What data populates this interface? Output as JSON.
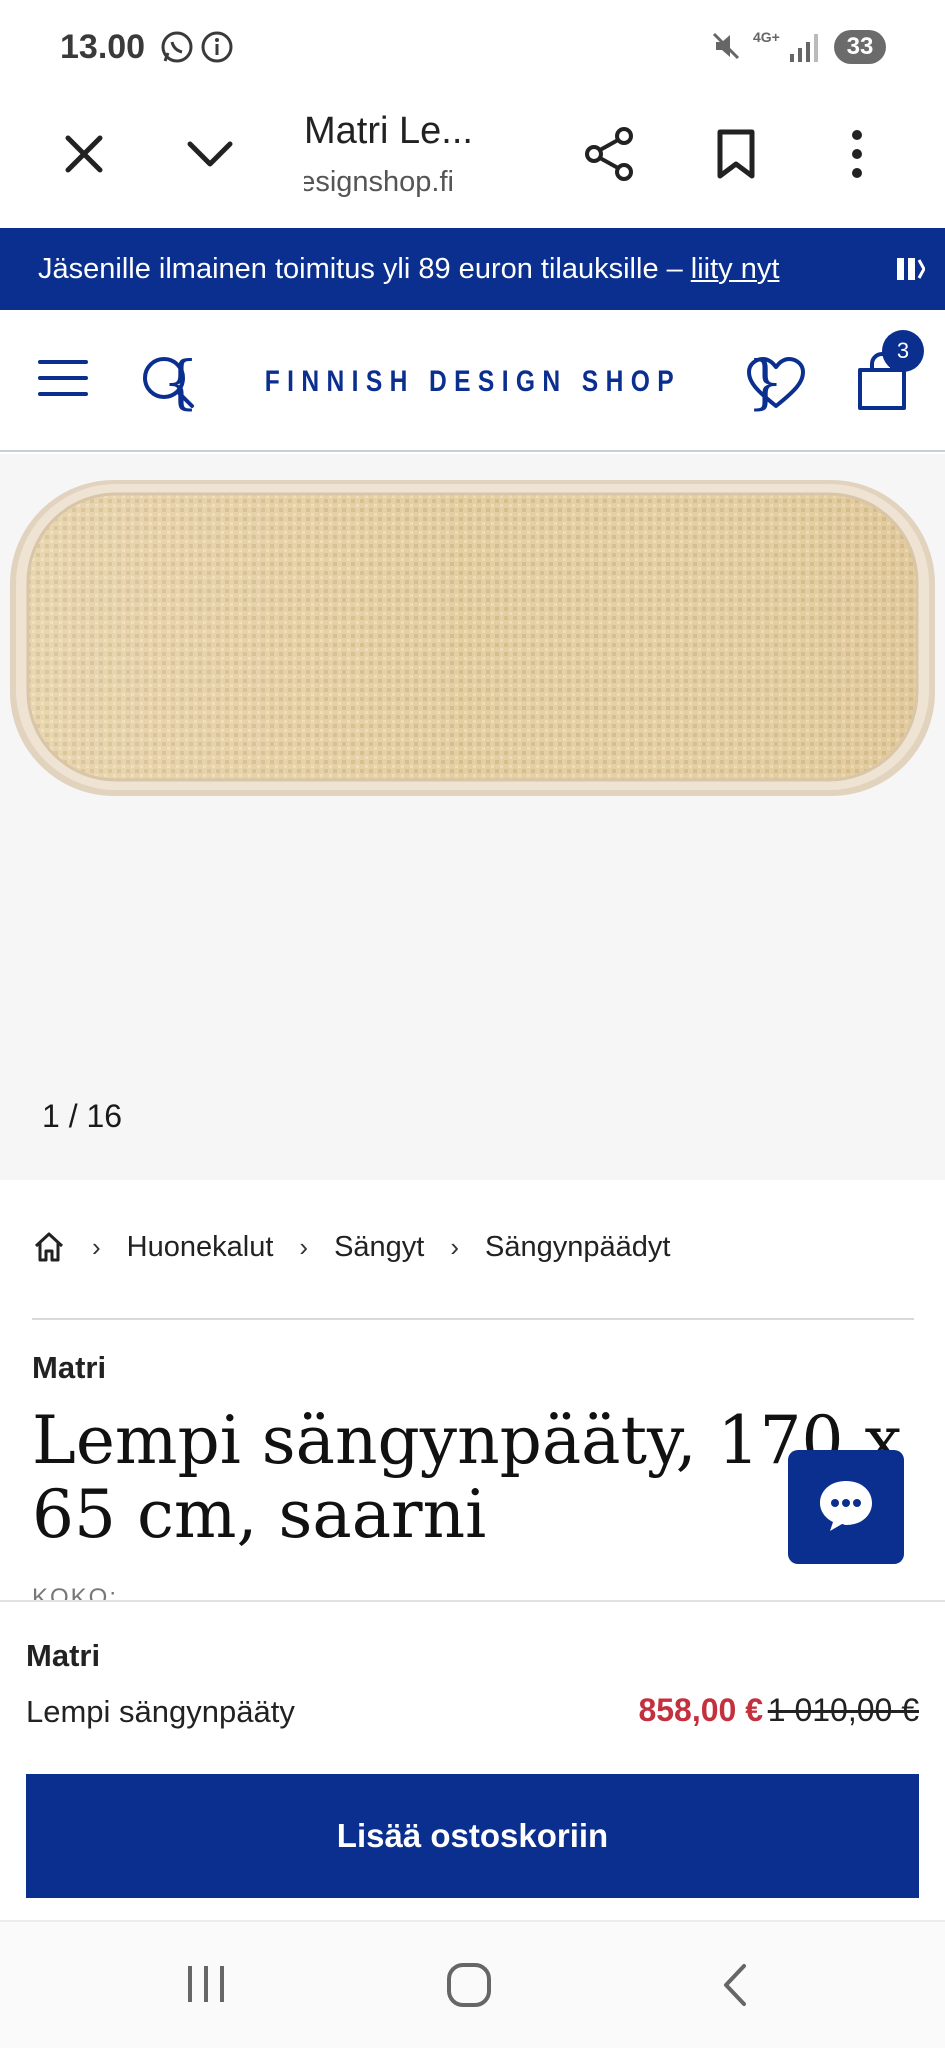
{
  "status_bar": {
    "time": "13.00",
    "network": "4G+",
    "battery": "33"
  },
  "browser": {
    "title": "Matri Le...",
    "url": "finnishdesignshop.fi"
  },
  "promo": {
    "text": "Jäsenille ilmainen toimitus yli 89 euron tilauksille –",
    "link": "liity nyt"
  },
  "header": {
    "brand": "FINNISH DESIGN SHOP",
    "cart_count": "3"
  },
  "gallery": {
    "counter": "1 / 16"
  },
  "breadcrumb": {
    "items": [
      "Huonekalut",
      "Sängyt",
      "Sängynpäädyt"
    ]
  },
  "product": {
    "brand": "Matri",
    "title_line1": "Lempi sängynpääty, 170 x",
    "title_line2": "65 cm, saarni",
    "size_label": "KOKO:"
  },
  "buybar": {
    "brand": "Matri",
    "name": "Lempi sängynpääty",
    "price_now": "858,00 €",
    "price_old": "1 010,00 €",
    "add_to_cart": "Lisää ostoskoriin"
  },
  "colors": {
    "brand_blue": "#0a2f8f",
    "sale_red": "#c3313e",
    "cane": "#e6d2a8",
    "frame": "#ecdcc7"
  },
  "icons": [
    "whatsapp-icon",
    "info-icon",
    "mute-icon",
    "signal-icon",
    "close-icon",
    "chevron-down-icon",
    "share-icon",
    "bookmark-icon",
    "more-icon",
    "menu-icon",
    "search-icon",
    "heart-icon",
    "cart-icon",
    "home-icon",
    "chat-icon",
    "recent-apps-icon",
    "home-nav-icon",
    "back-icon"
  ]
}
